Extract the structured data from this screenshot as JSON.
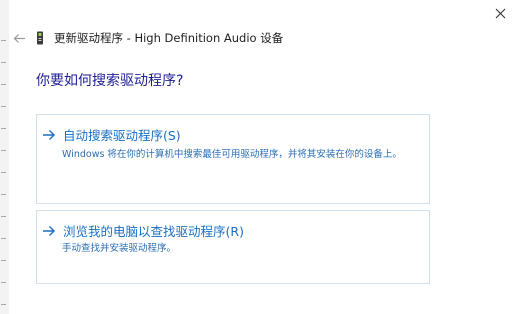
{
  "window": {
    "title": "更新驱动程序 - High Definition Audio 设备",
    "close_icon": "close-icon",
    "back_icon": "back-arrow-icon",
    "device_icon": "audio-device-icon"
  },
  "heading": "你要如何搜索驱动程序?",
  "options": [
    {
      "label": "自动搜索驱动程序(S)",
      "description": "Windows 将在你的计算机中搜索最佳可用驱动程序，并将其安装在你的设备上。",
      "icon": "arrow-right-icon"
    },
    {
      "label": "浏览我的电脑以查找驱动程序(R)",
      "description": "手动查找并安装驱动程序。",
      "icon": "arrow-right-icon"
    }
  ],
  "colors": {
    "heading": "#1e1e96",
    "link": "#1a6fc4",
    "card_border": "#cfe0ee"
  }
}
